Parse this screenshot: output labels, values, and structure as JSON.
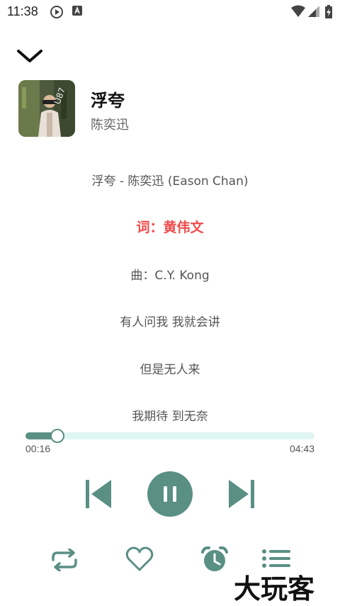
{
  "status_bar": {
    "time": "11:38"
  },
  "song": {
    "title": "浮夸",
    "artist": "陈奕迅"
  },
  "lyrics": [
    {
      "text": "浮夸 - 陈奕迅 (Eason Chan)",
      "active": false
    },
    {
      "text": "词：黄伟文",
      "active": true
    },
    {
      "text": "曲：C.Y. Kong",
      "active": false
    },
    {
      "text": "有人问我 我就会讲",
      "active": false
    },
    {
      "text": "但是无人来",
      "active": false
    },
    {
      "text": "我期待 到无奈",
      "active": false
    }
  ],
  "player": {
    "elapsed": "00:16",
    "duration": "04:43",
    "progress_fraction": 0.057
  },
  "colors": {
    "accent": "#5a8f84",
    "active_lyric": "#f04a4a",
    "track": "#dff5f1"
  },
  "watermark": "大玩客",
  "icons": {
    "collapse": "chevron-down-icon",
    "previous": "skip-previous-icon",
    "pause": "pause-icon",
    "next": "skip-next-icon",
    "repeat": "repeat-icon",
    "favorite": "heart-icon",
    "timer": "alarm-icon",
    "playlist": "playlist-icon"
  }
}
